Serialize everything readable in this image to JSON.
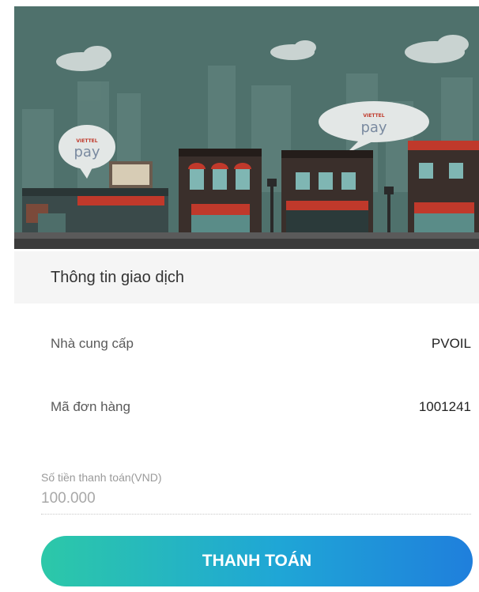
{
  "banner": {
    "bubble_left_text": "pay",
    "bubble_left_brand": "VIETTEL",
    "bubble_right_text": "pay",
    "bubble_right_brand": "VIETTEL"
  },
  "section": {
    "title": "Thông tin giao dịch"
  },
  "details": [
    {
      "label": "Nhà cung cấp",
      "value": "PVOIL"
    },
    {
      "label": "Mã đơn hàng",
      "value": "1001241"
    }
  ],
  "amount": {
    "label": "Số tiền thanh toán(VND)",
    "value": "100.000"
  },
  "pay_button": {
    "label": "THANH TOÁN"
  },
  "colors": {
    "sky": "#4f716c",
    "button_start": "#2cc8a8",
    "button_end": "#1f7fdc"
  }
}
